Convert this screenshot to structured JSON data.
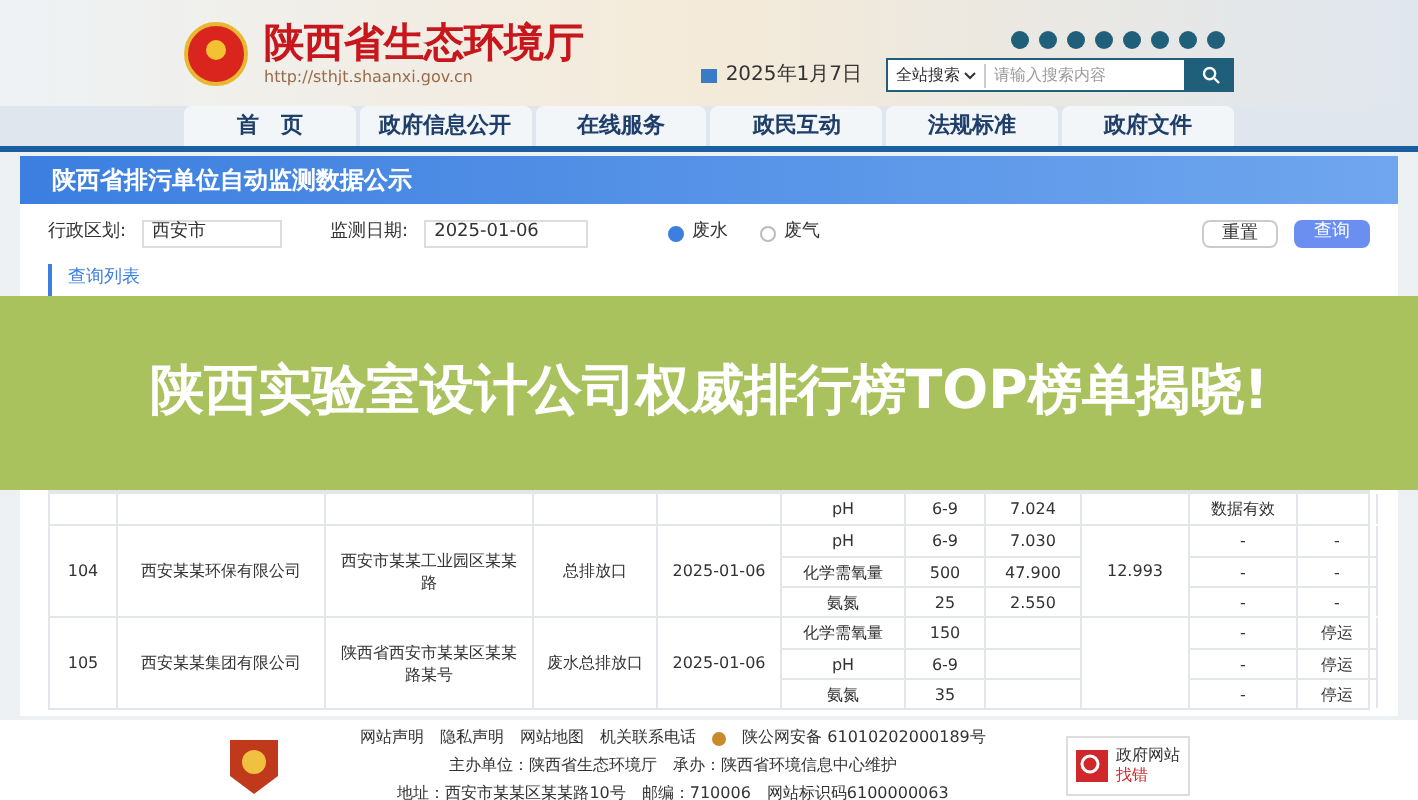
{
  "header": {
    "site_title": "陕西省生态环境厅",
    "url": "http://sthjt.shaanxi.gov.cn",
    "date": "2025年1月7日",
    "search": {
      "scope": "全站搜索",
      "placeholder": "请输入搜索内容"
    }
  },
  "nav": [
    {
      "label": "首　页",
      "selected": false
    },
    {
      "label": "政府信息公开",
      "selected": false
    },
    {
      "label": "在线服务",
      "selected": false
    },
    {
      "label": "政民互动",
      "selected": false
    },
    {
      "label": "法规标准",
      "selected": false
    },
    {
      "label": "政府文件",
      "selected": false
    }
  ],
  "page_title": "陕西省排污单位自动监测数据公示",
  "filters": {
    "region_label": "行政区划:",
    "region_value": "西安市",
    "date_label": "监测日期:",
    "date_value": "2025-01-06",
    "radios": [
      {
        "label": "废水",
        "selected": true
      },
      {
        "label": "废气",
        "selected": false
      }
    ],
    "buttons": [
      {
        "label": "重置",
        "kind": "plain"
      },
      {
        "label": "查询",
        "kind": "primary"
      }
    ]
  },
  "list_title": "查询列表",
  "table": {
    "rows": [
      {
        "items": [
          {
            "name": "pH",
            "standard": "6-9",
            "value": "7.024",
            "status": "数据有效"
          }
        ]
      },
      {
        "no": "104",
        "company": "西安某某环保有限公司",
        "address": "西安市某某工业园区某某路",
        "point": "总排放口",
        "date": "2025-01-06",
        "flow": "12.993",
        "items": [
          {
            "name": "pH",
            "standard": "6-9",
            "value": "7.030",
            "status": "-",
            "remark": "-"
          },
          {
            "name": "化学需氧量",
            "standard": "500",
            "value": "47.900",
            "status": "-",
            "remark": "-"
          },
          {
            "name": "氨氮",
            "standard": "25",
            "value": "2.550",
            "status": "-",
            "remark": "-"
          }
        ]
      },
      {
        "no": "105",
        "company": "西安某某集团有限公司",
        "address": "陕西省西安市某某区某某路某号",
        "point": "废水总排放口",
        "date": "2025-01-06",
        "items": [
          {
            "name": "化学需氧量",
            "standard": "150",
            "status": "-",
            "remark": "停运"
          },
          {
            "name": "pH",
            "standard": "6-9",
            "status": "-",
            "remark": "停运"
          },
          {
            "name": "氨氮",
            "standard": "35",
            "status": "-",
            "remark": "停运"
          }
        ]
      }
    ]
  },
  "footer": {
    "links": [
      "网站声明",
      "隐私声明",
      "网站地图",
      "机关联系电话"
    ],
    "beian": "陕公网安备 61010202000189号",
    "line2": "主办单位：陕西省生态环境厅　承办：陕西省环境信息中心维护",
    "line3": "地址：西安市某某区某某路10号　邮编：710006　网站标识码6100000063",
    "badge_top": "政府网站",
    "badge_bottom": "找错"
  },
  "overlay": {
    "title": "陕西实验室设计公司权威排行榜TOP榜单揭晓!"
  }
}
